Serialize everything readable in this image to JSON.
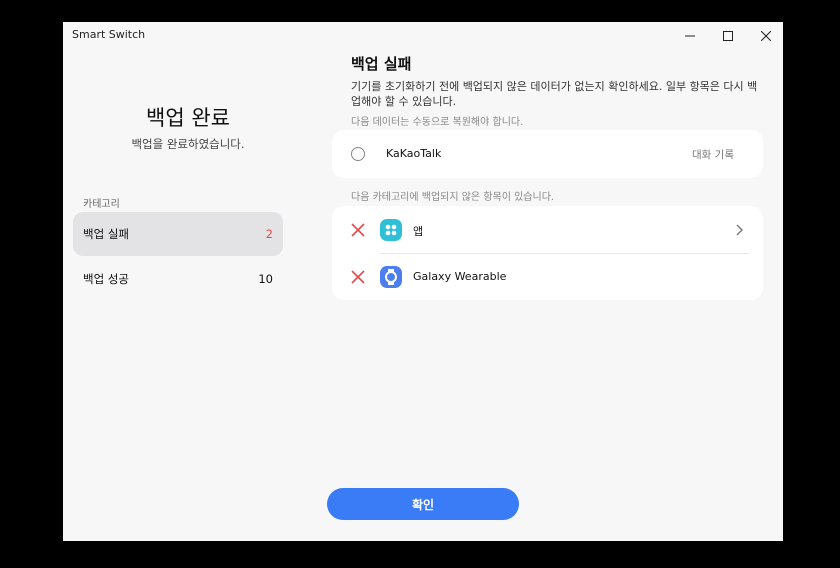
{
  "window": {
    "title": "Smart Switch"
  },
  "summary": {
    "title": "백업 완료",
    "subtitle": "백업을 완료하였습니다."
  },
  "categories": {
    "label": "카테고리",
    "items": [
      {
        "label": "백업 실패",
        "count": "2",
        "selected": true
      },
      {
        "label": "백업 성공",
        "count": "10",
        "selected": false
      }
    ]
  },
  "detail": {
    "title": "백업 실패",
    "description": "기기를 초기화하기 전에 백업되지 않은 데이터가 없는지 확인하세요. 일부 항목은 다시 백업해야 할 수 있습니다.",
    "manual_note": "다음 데이터는 수동으로 복원해야 합니다.",
    "manual_items": [
      {
        "label": "KaKaoTalk",
        "meta": "대화 기록"
      }
    ],
    "failed_note": "다음 카테고리에 백업되지 않은 항목이 있습니다.",
    "failed_items": [
      {
        "label": "앱",
        "icon": "apps-icon",
        "icon_color": "#2fc0d8"
      },
      {
        "label": "Galaxy Wearable",
        "icon": "wearable-icon",
        "icon_color": "#4d7ef0"
      }
    ]
  },
  "actions": {
    "confirm_label": "확인"
  },
  "colors": {
    "accent": "#3a7bf6",
    "fail": "#e24b4b"
  }
}
